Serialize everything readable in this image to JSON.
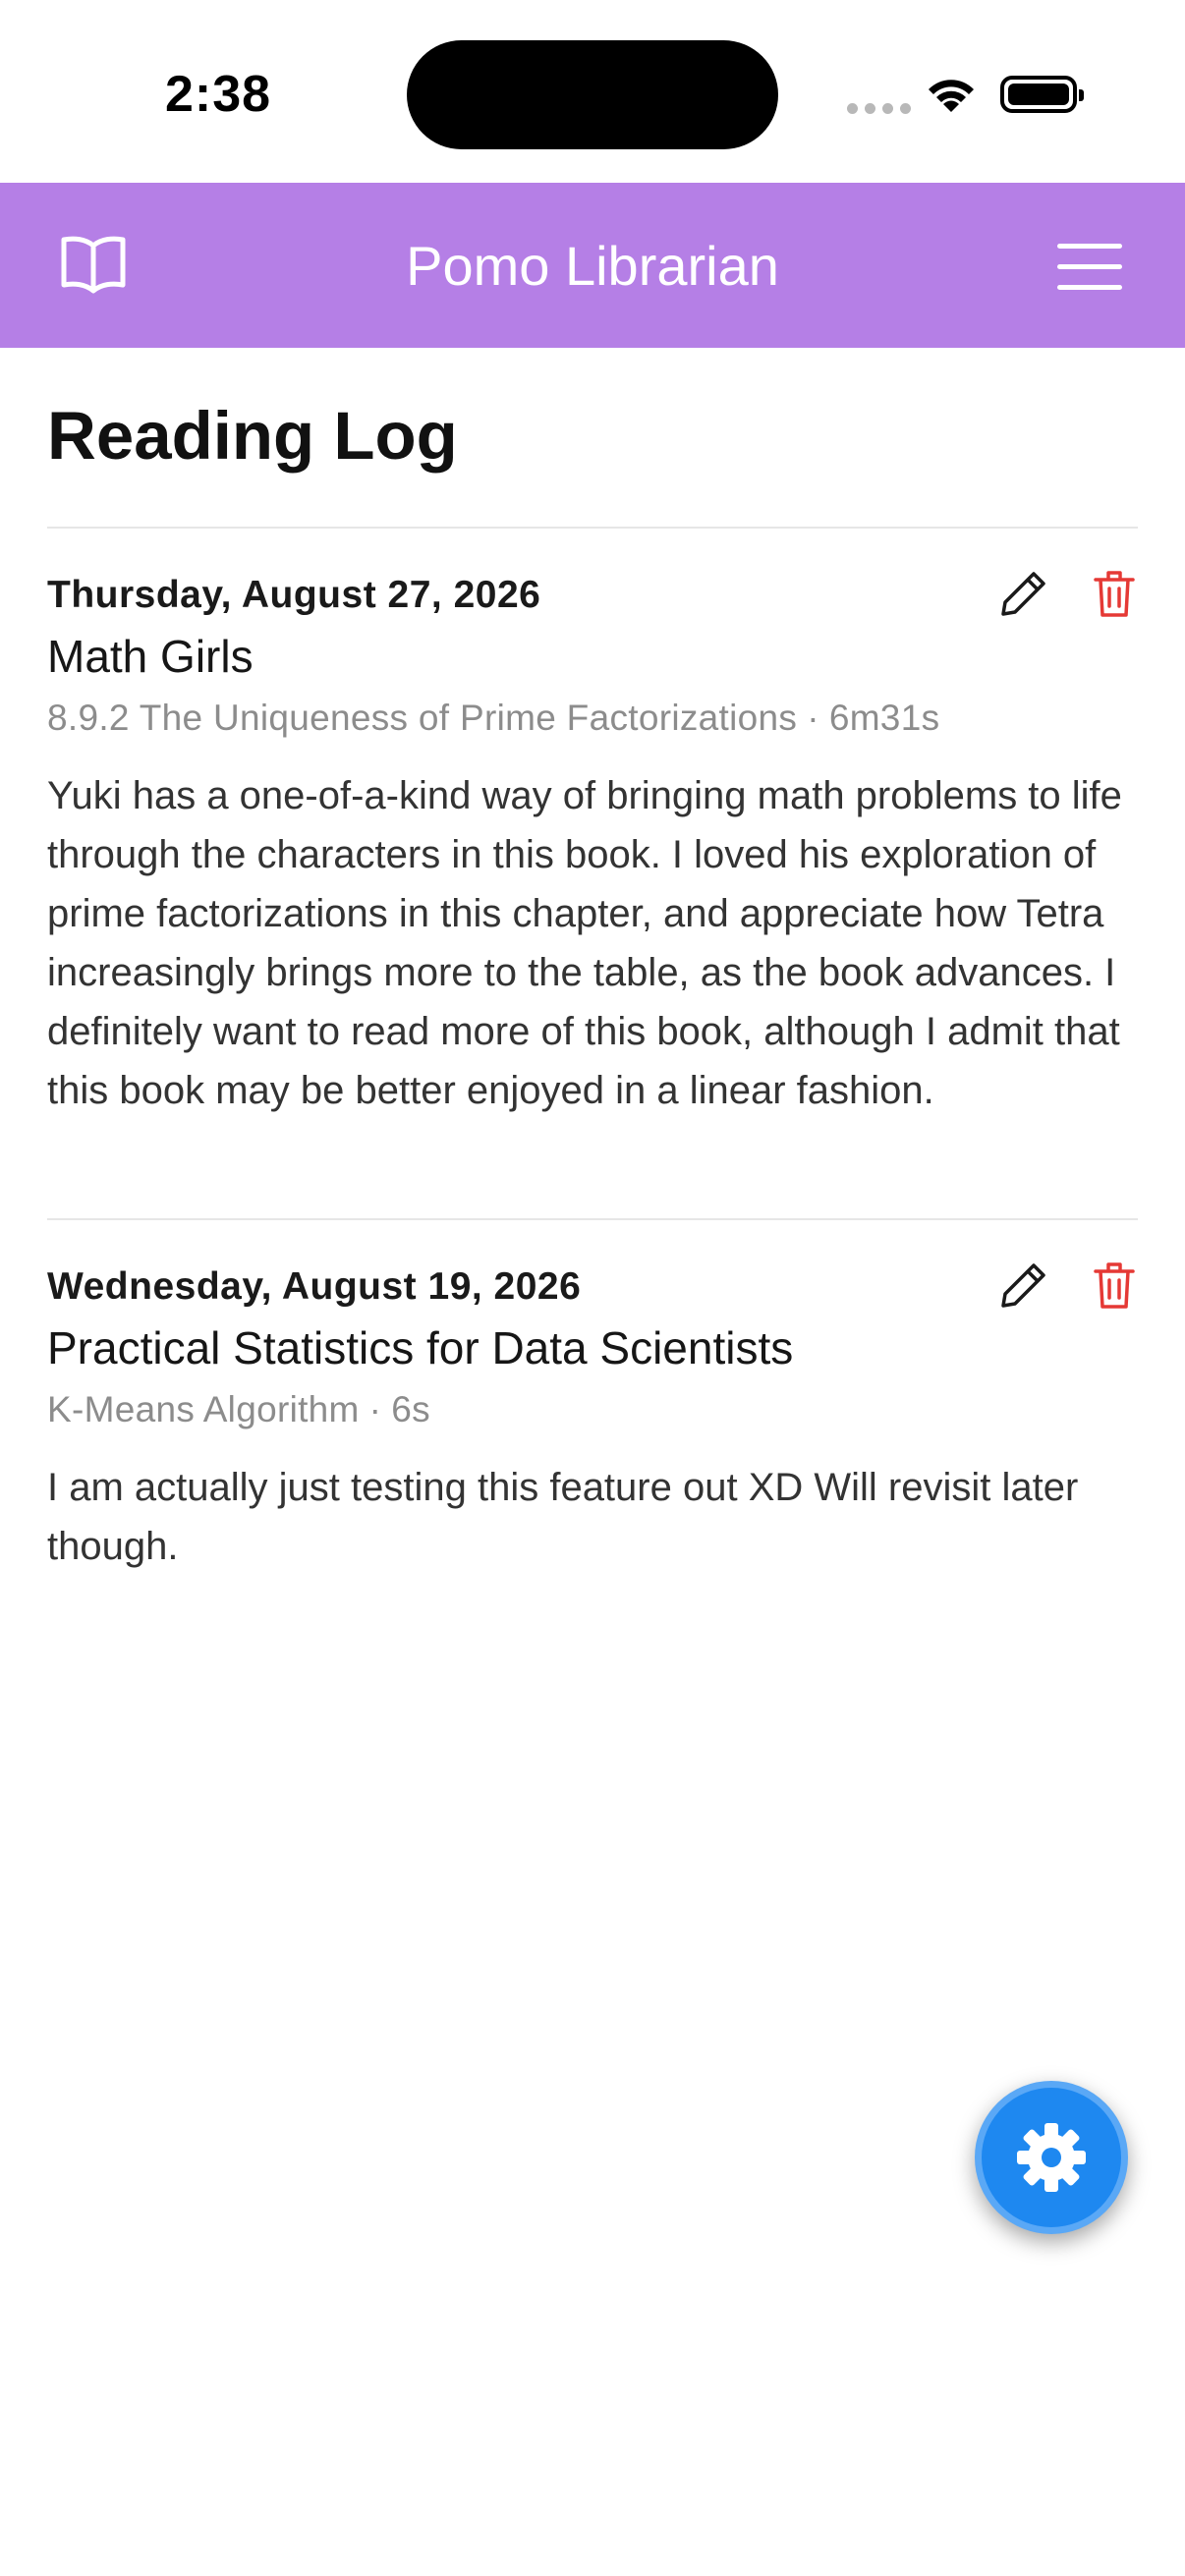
{
  "status_bar": {
    "time": "2:38"
  },
  "navbar": {
    "title": "Pomo Librarian",
    "left_icon": "book-open-icon",
    "right_icon": "hamburger-menu-icon",
    "background_color": "#b57fe6"
  },
  "page": {
    "heading": "Reading Log"
  },
  "entries": [
    {
      "date": "Thursday, August 27, 2026",
      "book_title": "Math Girls",
      "section": "8.9.2 The Uniqueness of Prime Factorizations",
      "separator": "·",
      "duration": "6m31s",
      "note": "Yuki has a one-of-a-kind way of bringing math problems to life through the characters in this book. I loved his exploration of prime factorizations in this chapter, and appreciate how Tetra increasingly brings more to the table, as the book advances. I definitely want to read more of this book, although I admit that this book may be better enjoyed in a linear fashion."
    },
    {
      "date": "Wednesday, August 19, 2026",
      "book_title": "Practical Statistics for Data Scientists",
      "section": "K-Means Algorithm",
      "separator": "·",
      "duration": "6s",
      "note": "I am actually just testing this feature out XD Will revisit later though."
    }
  ],
  "icons": {
    "edit": "pencil-icon",
    "delete": "trash-icon",
    "fab": "gear-icon"
  },
  "colors": {
    "delete_red": "#e53935",
    "fab_blue": "#1e88f0"
  }
}
